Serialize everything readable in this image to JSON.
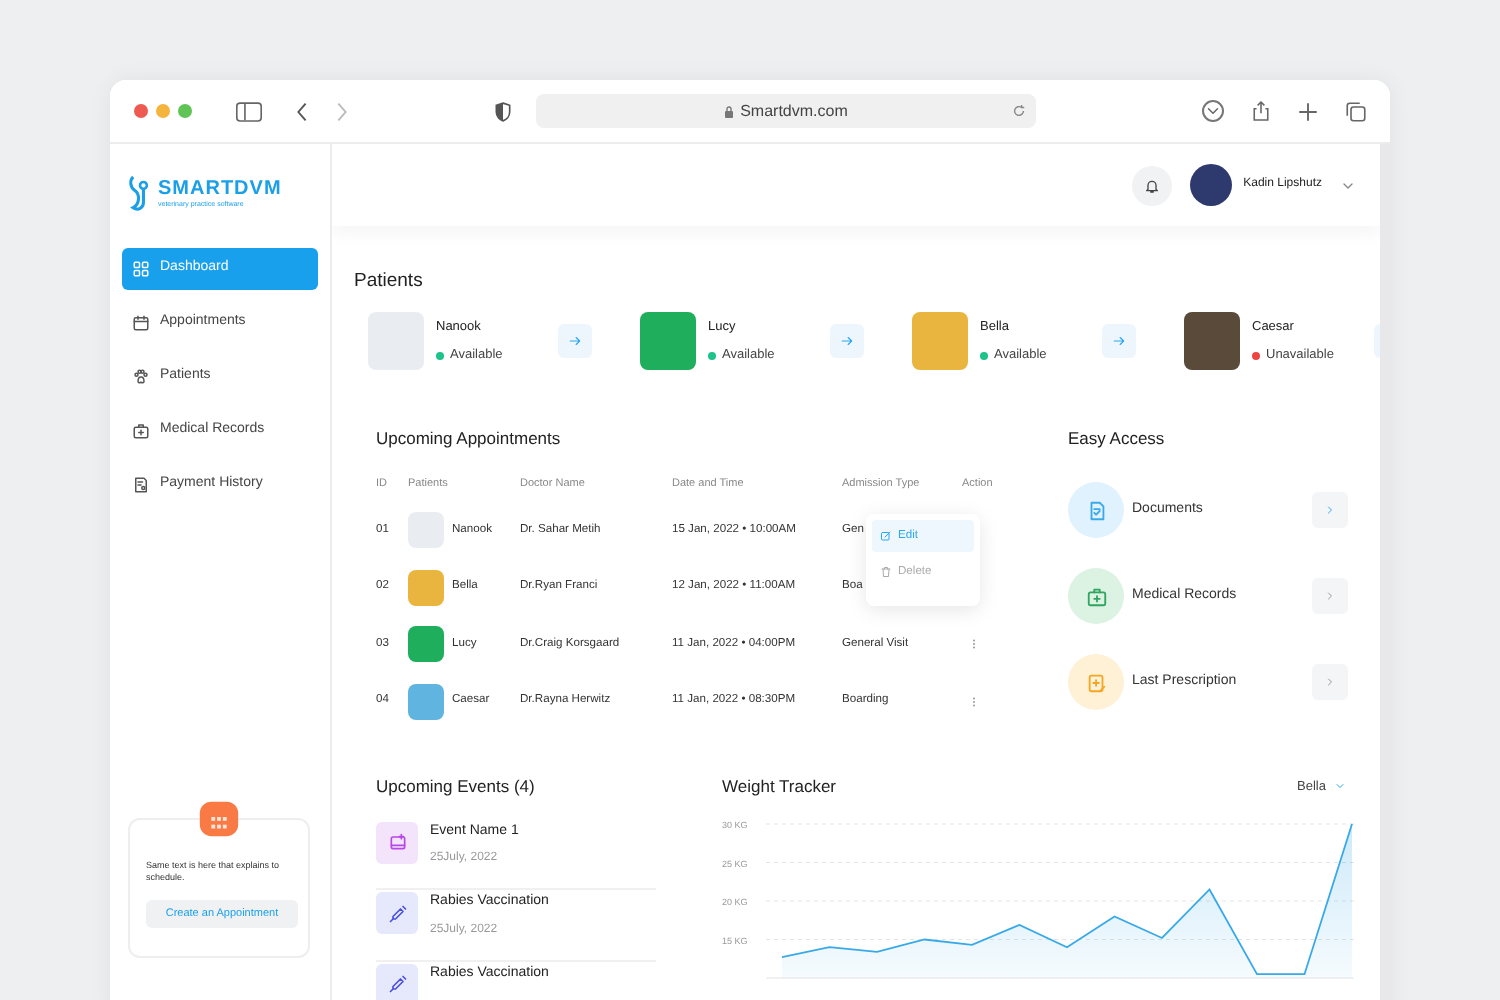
{
  "browser": {
    "url": "Smartdvm.com"
  },
  "logo": {
    "name": "SMARTDVM",
    "tagline": "veterinary practice software"
  },
  "sidebar": {
    "items": [
      {
        "label": "Dashboard",
        "selected": true
      },
      {
        "label": "Appointments",
        "selected": false
      },
      {
        "label": "Patients",
        "selected": false
      },
      {
        "label": "Medical Records",
        "selected": false
      },
      {
        "label": "Payment History",
        "selected": false
      }
    ],
    "promo": {
      "text": "Same text is here that explains to schedule.",
      "button": "Create an Appointment"
    }
  },
  "header": {
    "user": "Kadin Lipshutz"
  },
  "patients": {
    "title": "Patients",
    "items": [
      {
        "name": "Nanook",
        "status": "Available",
        "available": true,
        "color": "#e9edf2"
      },
      {
        "name": "Lucy",
        "status": "Available",
        "available": true,
        "color": "#1fae5b"
      },
      {
        "name": "Bella",
        "status": "Available",
        "available": true,
        "color": "#e9b53e"
      },
      {
        "name": "Caesar",
        "status": "Unavailable",
        "available": false,
        "color": "#5a4a3a"
      }
    ]
  },
  "appointments": {
    "title": "Upcoming Appointments",
    "columns": [
      "ID",
      "Patients",
      "Doctor Name",
      "Date and Time",
      "Admission Type",
      "Action"
    ],
    "rows": [
      {
        "id": "01",
        "patient": "Nanook",
        "color": "#e9edf2",
        "doctor": "Dr. Sahar Metih",
        "date": "15 Jan, 2022 • 10:00AM",
        "type": "Gen"
      },
      {
        "id": "02",
        "patient": "Bella",
        "color": "#e9b53e",
        "doctor": "Dr.Ryan Franci",
        "date": "12 Jan, 2022 • 11:00AM",
        "type": "Boa"
      },
      {
        "id": "03",
        "patient": "Lucy",
        "color": "#1fae5b",
        "doctor": "Dr.Craig Korsgaard",
        "date": "11 Jan, 2022 • 04:00PM",
        "type": "General Visit"
      },
      {
        "id": "04",
        "patient": "Caesar",
        "color": "#5fb4e0",
        "doctor": "Dr.Rayna Herwitz",
        "date": "11 Jan, 2022 • 08:30PM",
        "type": "Boarding"
      }
    ],
    "menu": [
      {
        "label": "Edit",
        "kind": "edit",
        "selected": true
      },
      {
        "label": "Delete",
        "kind": "delete",
        "selected": false
      }
    ]
  },
  "easy_access": {
    "title": "Easy Access",
    "items": [
      {
        "label": "Documents",
        "kind": "document",
        "color": "#e0f2fe"
      },
      {
        "label": "Medical Records",
        "kind": "kit",
        "color": "#dcf2e3"
      },
      {
        "label": "Last Prescription",
        "kind": "prescription",
        "color": "#fff1d6"
      }
    ]
  },
  "events": {
    "title": "Upcoming Events (4)",
    "items": [
      {
        "name": "Event Name 1",
        "date": "25July, 2022",
        "kind": "event",
        "color": "#f3e3fb"
      },
      {
        "name": "Rabies Vaccination",
        "date": "25July, 2022",
        "kind": "vaccine",
        "color": "#e6e8fb"
      },
      {
        "name": "Rabies Vaccination",
        "kind": "vaccine",
        "color": "#e6e8fb"
      }
    ]
  },
  "weight_tracker": {
    "title": "Weight Tracker",
    "pet": "Bella",
    "chart_data": {
      "type": "area",
      "grid": true,
      "ylim": [
        10,
        30
      ],
      "yticks": [
        {
          "value": 15,
          "label": "15 KG"
        },
        {
          "value": 20,
          "label": "20 KG"
        },
        {
          "value": 25,
          "label": "25 KG"
        },
        {
          "value": 30,
          "label": "30 KG"
        }
      ],
      "series": [
        {
          "color": "#38a9e8",
          "values": [
            12.7,
            14,
            13.4,
            15,
            14.3,
            16.9,
            14,
            18,
            15.2,
            21.5,
            10.5,
            10.5,
            30
          ]
        }
      ]
    }
  }
}
